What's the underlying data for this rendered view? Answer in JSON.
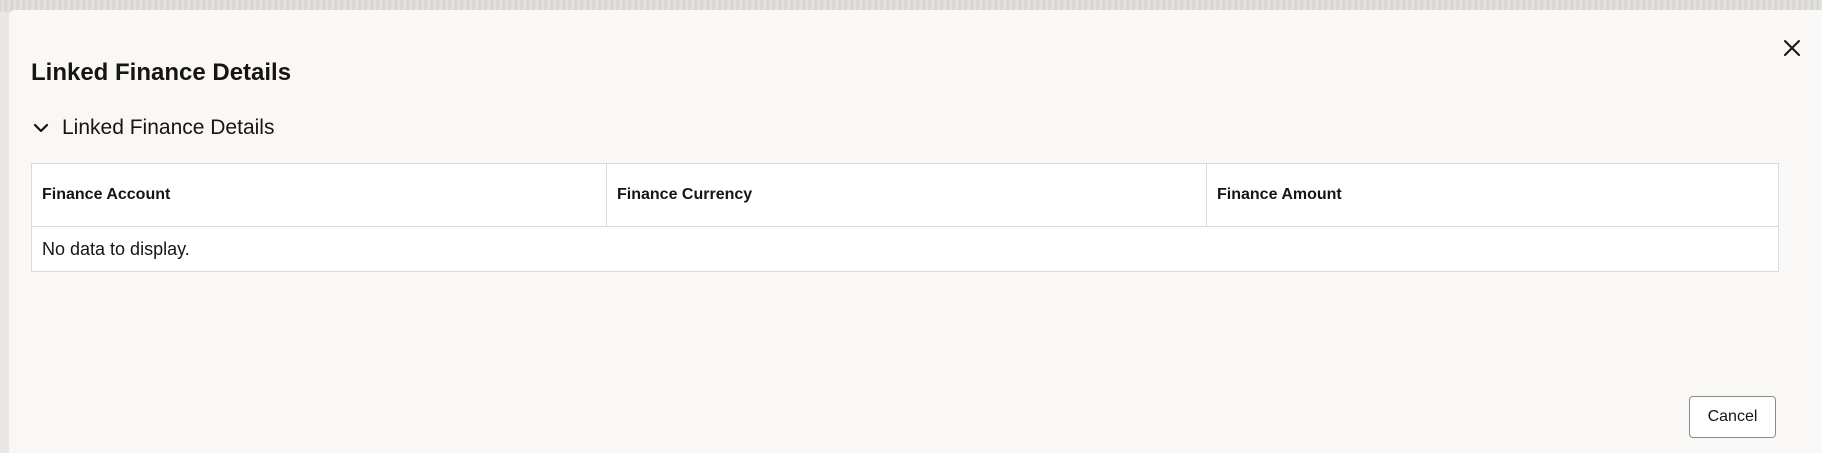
{
  "dialog": {
    "title": "Linked Finance Details",
    "close_icon": "close-icon"
  },
  "section": {
    "title": "Linked Finance Details",
    "expanded": true,
    "chevron_icon": "chevron-down-icon"
  },
  "table": {
    "columns": [
      "Finance Account",
      "Finance Currency",
      "Finance Amount"
    ],
    "rows": [],
    "empty_message": "No data to display."
  },
  "footer": {
    "cancel_label": "Cancel"
  },
  "colors": {
    "dialog_background": "#f9f8f7",
    "text": "#161513",
    "border": "#dcdad7"
  }
}
